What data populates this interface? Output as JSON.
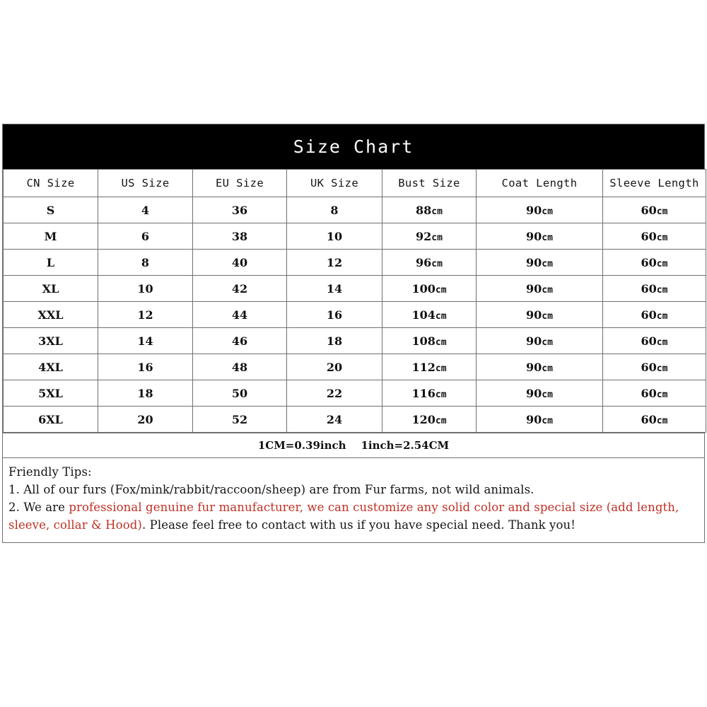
{
  "page": {
    "background_color": "#ffffff"
  },
  "chart": {
    "title": "Size Chart",
    "title_band_color": "#000000",
    "title_text_color": "#ffffff",
    "border_color": "#6f6f6f",
    "columns": [
      "CN Size",
      "US Size",
      "EU Size",
      "UK Size",
      "Bust Size",
      "Coat Length",
      "Sleeve Length"
    ],
    "rows": [
      {
        "cn": "S",
        "us": "4",
        "eu": "36",
        "uk": "8",
        "bust": "88cm",
        "coat": "90cm",
        "sleeve": "60cm"
      },
      {
        "cn": "M",
        "us": "6",
        "eu": "38",
        "uk": "10",
        "bust": "92cm",
        "coat": "90cm",
        "sleeve": "60cm"
      },
      {
        "cn": "L",
        "us": "8",
        "eu": "40",
        "uk": "12",
        "bust": "96cm",
        "coat": "90cm",
        "sleeve": "60cm"
      },
      {
        "cn": "XL",
        "us": "10",
        "eu": "42",
        "uk": "14",
        "bust": "100cm",
        "coat": "90cm",
        "sleeve": "60cm"
      },
      {
        "cn": "XXL",
        "us": "12",
        "eu": "44",
        "uk": "16",
        "bust": "104cm",
        "coat": "90cm",
        "sleeve": "60cm"
      },
      {
        "cn": "3XL",
        "us": "14",
        "eu": "46",
        "uk": "18",
        "bust": "108cm",
        "coat": "90cm",
        "sleeve": "60cm"
      },
      {
        "cn": "4XL",
        "us": "16",
        "eu": "48",
        "uk": "20",
        "bust": "112cm",
        "coat": "90cm",
        "sleeve": "60cm"
      },
      {
        "cn": "5XL",
        "us": "18",
        "eu": "50",
        "uk": "22",
        "bust": "116cm",
        "coat": "90cm",
        "sleeve": "60cm"
      },
      {
        "cn": "6XL",
        "us": "20",
        "eu": "52",
        "uk": "24",
        "bust": "120cm",
        "coat": "90cm",
        "sleeve": "60cm"
      }
    ],
    "conversion_note": "1CM=0.39inch    1inch=2.54CM"
  },
  "tips": {
    "heading": "Friendly Tips:",
    "item1": "1. All of our furs (Fox/mink/rabbit/raccoon/sheep) are from Fur farms, not wild animals.",
    "item2_prefix": "2. We are ",
    "item2_red": "professional genuine fur manufacturer, we can customize any solid color and special size (add length, sleeve, collar & Hood)",
    "item2_suffix": ". Please feel free to contact with us if you have special need. Thank you!",
    "red_color": "#bf3025"
  }
}
